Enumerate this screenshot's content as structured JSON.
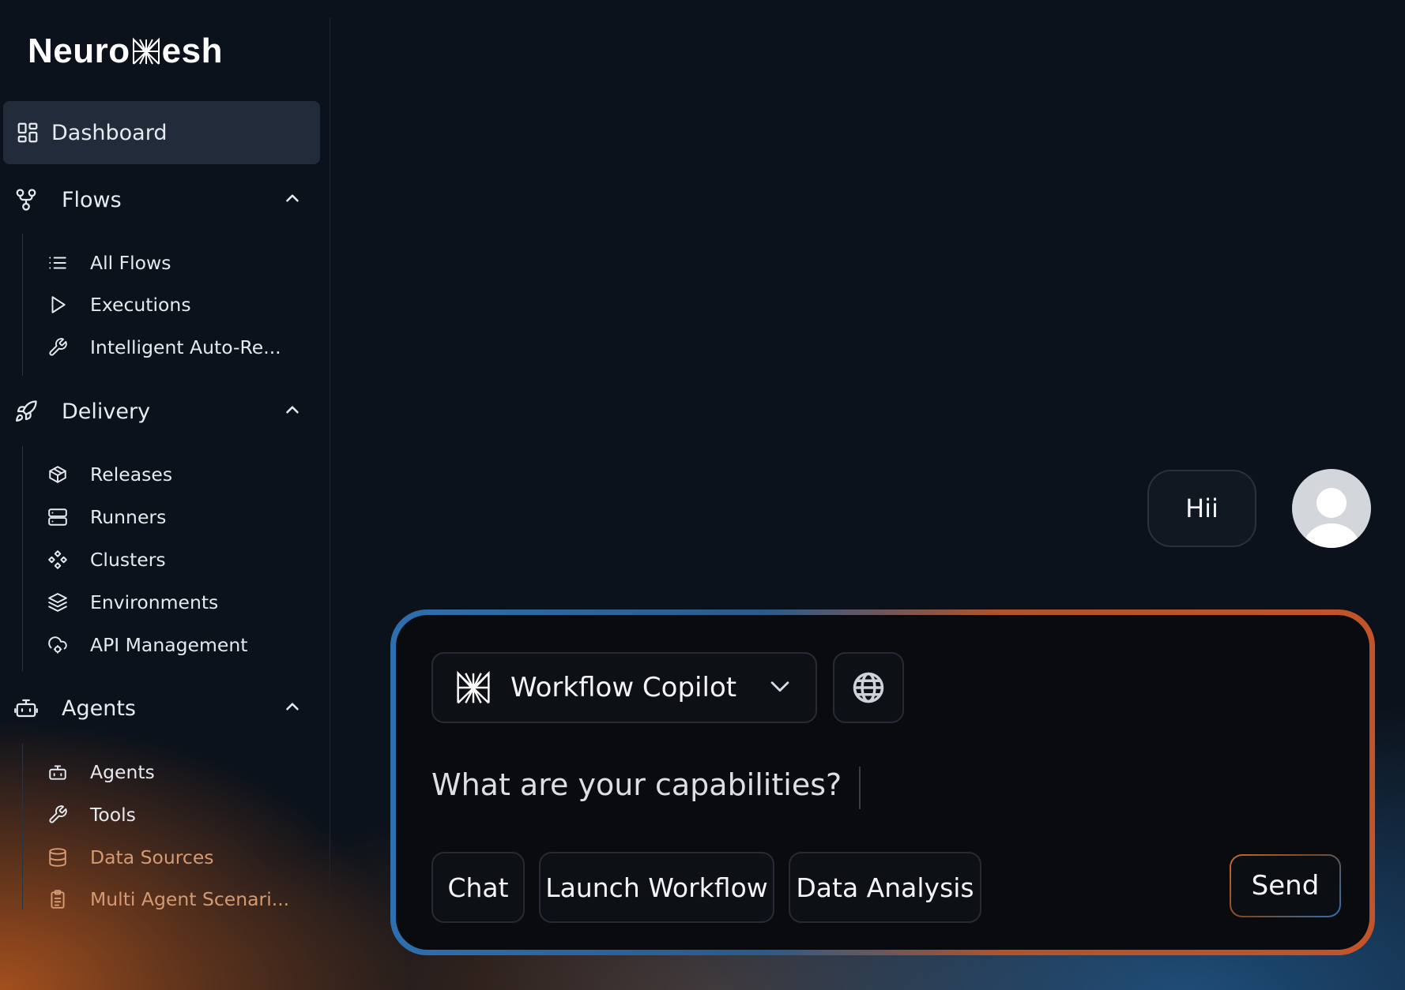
{
  "brand": {
    "name_prefix": "Neuro",
    "name_suffix": "esh"
  },
  "sidebar": {
    "dashboard": {
      "label": "Dashboard",
      "icon": "dashboard-grid-icon"
    },
    "sections": [
      {
        "label": "Flows",
        "icon": "flows-icon",
        "expanded": true,
        "items": [
          {
            "label": "All Flows",
            "icon": "list-icon"
          },
          {
            "label": "Executions",
            "icon": "play-icon"
          },
          {
            "label": "Intelligent Auto-Re...",
            "icon": "wrench-icon"
          }
        ]
      },
      {
        "label": "Delivery",
        "icon": "rocket-icon",
        "expanded": true,
        "items": [
          {
            "label": "Releases",
            "icon": "package-icon"
          },
          {
            "label": "Runners",
            "icon": "server-icon"
          },
          {
            "label": "Clusters",
            "icon": "clusters-icon"
          },
          {
            "label": "Environments",
            "icon": "layers-icon"
          },
          {
            "label": "API Management",
            "icon": "cloud-cog-icon"
          }
        ]
      },
      {
        "label": "Agents",
        "icon": "bot-icon",
        "expanded": true,
        "items": [
          {
            "label": "Agents",
            "icon": "bot-icon"
          },
          {
            "label": "Tools",
            "icon": "wrench-icon"
          },
          {
            "label": "Data Sources",
            "icon": "database-icon"
          },
          {
            "label": "Multi Agent Scenari...",
            "icon": "clipboard-icon"
          }
        ]
      }
    ]
  },
  "chat": {
    "messages": [
      {
        "role": "user",
        "text": "Hii"
      }
    ]
  },
  "composer": {
    "model_label": "Workflow Copilot",
    "prompt_value": "What are your capabilities?",
    "chips": [
      "Chat",
      "Launch Workflow",
      "Data Analysis"
    ],
    "send_label": "Send"
  },
  "colors": {
    "background": "#0c121b",
    "active_item": "#212b39",
    "accent_blue": "#2e6fae",
    "accent_orange": "#c2542a",
    "muted_orange_text": "#d59a71"
  }
}
